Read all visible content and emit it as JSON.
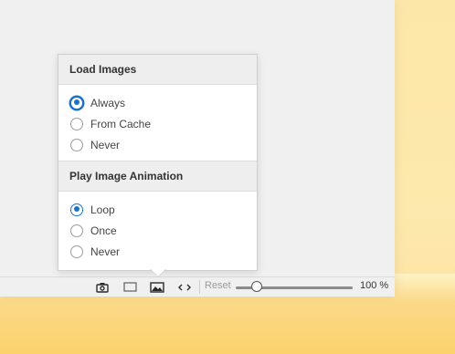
{
  "popup": {
    "load_images": {
      "title": "Load Images",
      "options": [
        {
          "label": "Always",
          "checked": true
        },
        {
          "label": "From Cache",
          "checked": false
        },
        {
          "label": "Never",
          "checked": false
        }
      ]
    },
    "play_animation": {
      "title": "Play Image Animation",
      "options": [
        {
          "label": "Loop",
          "checked": true
        },
        {
          "label": "Once",
          "checked": false
        },
        {
          "label": "Never",
          "checked": false
        }
      ]
    }
  },
  "statusbar": {
    "icons": [
      "camera-icon",
      "window-icon",
      "image-icon",
      "code-icon"
    ],
    "reset_label": "Reset",
    "zoom_label": "100 %",
    "zoom_percent": 100
  },
  "colors": {
    "accent": "#1a73c8",
    "window_bg": "#f0f0f0",
    "backdrop": "#fcd97a"
  }
}
